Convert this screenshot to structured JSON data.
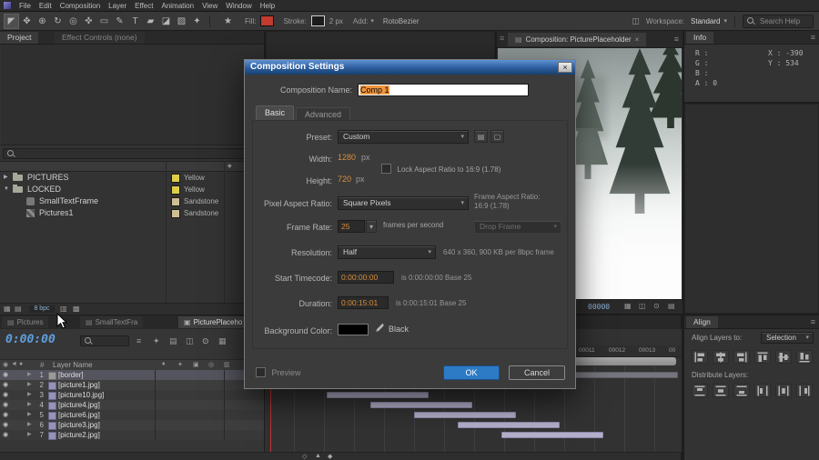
{
  "menu": {
    "items": [
      "File",
      "Edit",
      "Composition",
      "Layer",
      "Effect",
      "Animation",
      "View",
      "Window",
      "Help"
    ]
  },
  "toolbar": {
    "tools": [
      {
        "name": "selection-tool",
        "glyph": "◤"
      },
      {
        "name": "hand-tool",
        "glyph": "✥"
      },
      {
        "name": "zoom-tool",
        "glyph": "⊕"
      },
      {
        "name": "rotation-tool",
        "glyph": "↻"
      },
      {
        "name": "camera-tool",
        "glyph": "◎"
      },
      {
        "name": "pan-behind-tool",
        "glyph": "✜"
      },
      {
        "name": "shape-tool",
        "glyph": "▭"
      },
      {
        "name": "pen-tool",
        "glyph": "✎"
      },
      {
        "name": "type-tool",
        "glyph": "T"
      },
      {
        "name": "brush-tool",
        "glyph": "▰"
      },
      {
        "name": "clone-stamp-tool",
        "glyph": "◪"
      },
      {
        "name": "eraser-tool",
        "glyph": "▨"
      },
      {
        "name": "puppet-pin-tool",
        "glyph": "✦"
      }
    ],
    "star_glyph": "★",
    "fill_label": "Fill:",
    "fill_color": "#c23b2e",
    "stroke_label": "Stroke:",
    "stroke_width": "2 px",
    "add_label": "Add:",
    "rotobezier_label": "RotoBezier",
    "workspace_label": "Workspace:",
    "workspace_value": "Standard",
    "search_placeholder": "Search Help"
  },
  "project": {
    "tabs": [
      "Project",
      "Effect Controls (none)"
    ],
    "items": [
      {
        "arrow": "▶",
        "name": "PICTURES",
        "color_name": "Yellow",
        "color": "#ddce4a"
      },
      {
        "arrow": "▼",
        "name": "LOCKED",
        "color_name": "Yellow",
        "color": "#ddce4a"
      },
      {
        "arrow": "",
        "name": "SmallTextFrame",
        "color_name": "Sandstone",
        "color": "#cfbd94"
      },
      {
        "arrow": "",
        "name": "Pictures1",
        "color_name": "Sandstone",
        "color": "#cfbd94"
      }
    ],
    "bpc_label": "8 bpc"
  },
  "dialog": {
    "title": "Composition Settings",
    "close_glyph": "×",
    "name_label": "Composition Name:",
    "name_value": "Comp 1",
    "tabs": [
      "Basic",
      "Advanced"
    ],
    "preset_label": "Preset:",
    "preset_value": "Custom",
    "width_label": "Width:",
    "width_value": "1280",
    "width_unit": "px",
    "height_label": "Height:",
    "height_value": "720",
    "height_unit": "px",
    "lock_aspect_label": "Lock Aspect Ratio to 16:9 (1.78)",
    "par_label": "Pixel Aspect Ratio:",
    "par_value": "Square Pixels",
    "frame_aspect_label": "Frame Aspect Ratio:",
    "frame_aspect_value": "16:9 (1.78)",
    "frame_rate_label": "Frame Rate:",
    "frame_rate_value": "25",
    "fps_suffix": "frames per second",
    "drop_frame_value": "Drop Frame",
    "resolution_label": "Resolution:",
    "resolution_value": "Half",
    "resolution_info": "640 x 360, 900 KB per 8bpc frame",
    "start_label": "Start Timecode:",
    "start_value": "0:00:00:00",
    "start_info": "is 0:00:00:00 Base 25",
    "duration_label": "Duration:",
    "duration_value": "0:00:15:01",
    "duration_info": "is 0:00:15:01 Base 25",
    "bg_label": "Background Color:",
    "bg_color": "#000000",
    "bg_value_name": "Black",
    "preview_label": "Preview",
    "ok_label": "OK",
    "cancel_label": "Cancel"
  },
  "viewer": {
    "tab_label": "Composition: PicturePlaceholder",
    "close_glyph": "×",
    "timecode": "00000"
  },
  "info": {
    "title": "Info",
    "lines_left": [
      "R :",
      "G :",
      "B :",
      "A : 0"
    ],
    "lines_right": [
      "X : -390",
      "Y : 534"
    ]
  },
  "align_panel": {
    "title": "Align",
    "align_to_label": "Align Layers to:",
    "align_to_value": "Selection",
    "distribute_label": "Distribute Layers:"
  },
  "timeline": {
    "tabs": [
      {
        "label": "Pictures"
      },
      {
        "label": "SmallTextFra"
      },
      {
        "label": "PicturePlaceho"
      }
    ],
    "timecode": "0:00:00",
    "num_header": "#",
    "name_header": "Layer Name",
    "layers": [
      {
        "num": "1",
        "name": "[border]"
      },
      {
        "num": "2",
        "name": "[picture1.jpg]"
      },
      {
        "num": "3",
        "name": "[picture10.jpg]"
      },
      {
        "num": "4",
        "name": "[picture4.jpg]"
      },
      {
        "num": "5",
        "name": "[picture6.jpg]"
      },
      {
        "num": "6",
        "name": "[picture3.jpg]"
      },
      {
        "num": "7",
        "name": "[picture2.jpg]"
      }
    ],
    "ruler_marks": [
      "00011",
      "00012",
      "00013",
      "00"
    ]
  },
  "colors": {
    "accent_blue": "#2d7bc4",
    "timecode_blue": "#5f9fe0",
    "hot_orange": "#d78e3d",
    "selection_orange": "#f0953f"
  }
}
